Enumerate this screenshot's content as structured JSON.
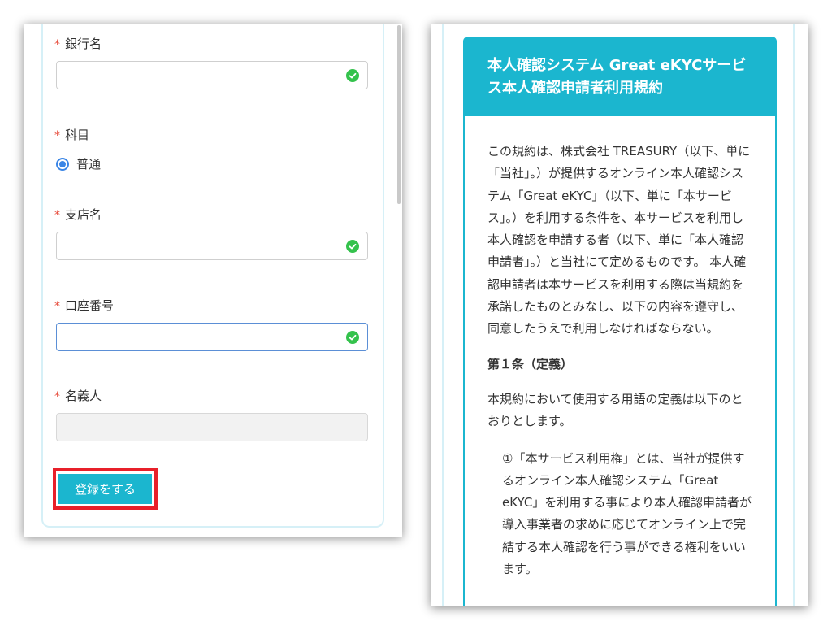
{
  "form": {
    "required_mark": "*",
    "bank_name_label": "銀行名",
    "subject_label": "科目",
    "subject_option": "普通",
    "branch_name_label": "支店名",
    "account_number_label": "口座番号",
    "holder_name_label": "名義人",
    "submit_label": "登録をする"
  },
  "terms": {
    "title": "本人確認システム Great eKYCサービス本人確認申請者利用規約",
    "intro": "この規約は、株式会社 TREASURY（以下、単に「当社」。）が提供するオンライン本人確認システム「Great eKYC」（以下、単に「本サービス」。）を利用する条件を、本サービスを利用し本人確認を申請する者（以下、単に「本人確認申請者」。）と当社にて定めるものです。 本人確認申請者は本サービスを利用する際は当規約を承諾したものとみなし、以下の内容を遵守し、同意したうえで利用しなければならない。",
    "article1_title": "第１条（定義）",
    "article1_text": "本規約において使用する用語の定義は以下のとおりとします。",
    "article1_item1": "①「本サービス利用権」とは、当社が提供するオンライン本人確認システム「Great eKYC」を利用する事により本人確認申請者が導入事業者の求めに応じてオンライン上で完結する本人確認を行う事ができる権利をいいます。"
  },
  "colors": {
    "accent": "#1bb6cf",
    "required": "#e74c3c",
    "highlight_frame": "#e8202a",
    "valid_check": "#34c24c",
    "radio": "#3b86e6"
  },
  "icons": {
    "valid": "check-circle-icon",
    "radio": "radio-selected-icon"
  }
}
